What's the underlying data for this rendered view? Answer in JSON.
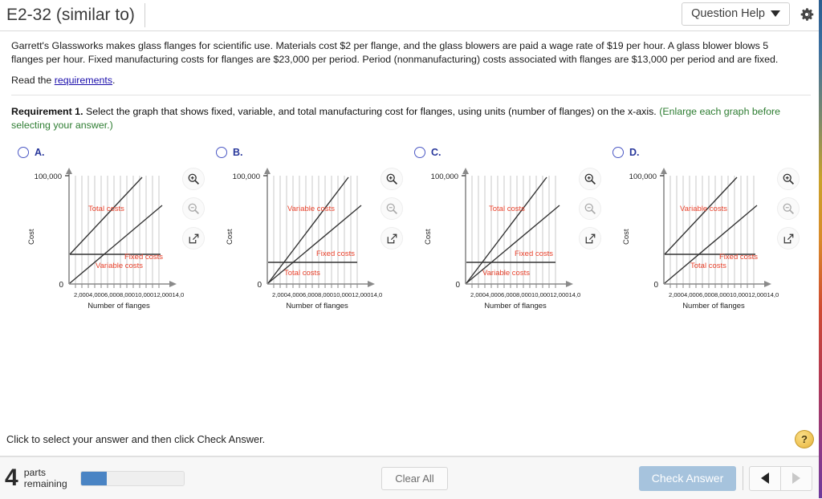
{
  "header": {
    "question_title": "E2-32 (similar to)",
    "question_help_label": "Question Help",
    "gear_icon": "gear-icon",
    "caret_icon": "chevron-down-icon"
  },
  "problem": {
    "text": "Garrett's Glassworks makes glass flanges for scientific use. Materials cost $2 per flange, and the glass blowers are paid a wage rate of $19 per hour. A glass blower blows 5 flanges per hour. Fixed manufacturing costs for flanges are $23,000 per period. Period (nonmanufacturing) costs associated with flanges are $13,000 per period and are fixed.",
    "read_prefix": "Read the ",
    "read_link": "requirements",
    "read_suffix": "."
  },
  "requirement": {
    "label": "Requirement 1.",
    "text": " Select the graph that shows fixed, variable, and total manufacturing cost for flanges, using units (number of flanges) on the x-axis. ",
    "note": "(Enlarge each graph before selecting your answer.)"
  },
  "options": [
    {
      "letter": "A.",
      "selected": false,
      "labels": {
        "upper": "Total costs",
        "lower": "Variable costs",
        "flat": "Fixed costs"
      }
    },
    {
      "letter": "B.",
      "selected": false,
      "labels": {
        "upper": "Variable costs",
        "lower": "Total costs",
        "flat": "Fixed costs"
      }
    },
    {
      "letter": "C.",
      "selected": false,
      "labels": {
        "upper": "Total costs",
        "lower": "Variable costs",
        "flat": "Fixed costs"
      }
    },
    {
      "letter": "D.",
      "selected": false,
      "labels": {
        "upper": "Variable costs",
        "lower": "Total costs",
        "flat": "Fixed costs"
      }
    }
  ],
  "graph_common": {
    "y_top_label": "100,000",
    "y_zero_label": "0",
    "y_axis_title": "Cost",
    "x_axis_title": "Number of flanges",
    "x_tick_labels": [
      "2,000",
      "4,000",
      "6,000",
      "8,000",
      "10,000",
      "12,000",
      "14,000"
    ],
    "line_color": "#333333",
    "label_color": "#e8402a",
    "grid_color": "#c9c9c9",
    "axis_color": "#8a8a8a"
  },
  "chart_data": [
    {
      "type": "line",
      "option": "A",
      "title": "Option A",
      "xlabel": "Number of flanges",
      "ylabel": "Cost",
      "xlim": [
        0,
        15000
      ],
      "ylim": [
        0,
        110000
      ],
      "ytick_labels": [
        "0",
        "100,000"
      ],
      "grid": true,
      "series": [
        {
          "name": "Total costs",
          "intercept": 23000,
          "slope_per_unit": 5.8,
          "label_position": "upper",
          "from_origin": false
        },
        {
          "name": "Variable costs",
          "intercept": 0,
          "slope_per_unit": 5.8,
          "label_position": "lower",
          "from_origin": true
        },
        {
          "name": "Fixed costs",
          "intercept": 23000,
          "slope_per_unit": 0,
          "label_position": "flat",
          "from_origin": false
        }
      ]
    },
    {
      "type": "line",
      "option": "B",
      "title": "Option B",
      "xlabel": "Number of flanges",
      "ylabel": "Cost",
      "xlim": [
        0,
        15000
      ],
      "ylim": [
        0,
        110000
      ],
      "ytick_labels": [
        "0",
        "100,000"
      ],
      "grid": true,
      "series": [
        {
          "name": "Variable costs",
          "intercept": 0,
          "slope_per_unit": 7.4,
          "label_position": "upper",
          "from_origin": true
        },
        {
          "name": "Total costs",
          "intercept": 0,
          "slope_per_unit": 5.3,
          "label_position": "lower",
          "from_origin": true
        },
        {
          "name": "Fixed costs",
          "intercept": 18000,
          "slope_per_unit": 0,
          "label_position": "flat",
          "from_origin": false
        }
      ]
    },
    {
      "type": "line",
      "option": "C",
      "title": "Option C",
      "xlabel": "Number of flanges",
      "ylabel": "Cost",
      "xlim": [
        0,
        15000
      ],
      "ylim": [
        0,
        110000
      ],
      "ytick_labels": [
        "0",
        "100,000"
      ],
      "grid": true,
      "series": [
        {
          "name": "Total costs",
          "intercept": 0,
          "slope_per_unit": 7.4,
          "label_position": "upper",
          "from_origin": true
        },
        {
          "name": "Variable costs",
          "intercept": 0,
          "slope_per_unit": 5.3,
          "label_position": "lower",
          "from_origin": true
        },
        {
          "name": "Fixed costs",
          "intercept": 18000,
          "slope_per_unit": 0,
          "label_position": "flat",
          "from_origin": false
        }
      ]
    },
    {
      "type": "line",
      "option": "D",
      "title": "Option D",
      "xlabel": "Number of flanges",
      "ylabel": "Cost",
      "xlim": [
        0,
        15000
      ],
      "ylim": [
        0,
        110000
      ],
      "ytick_labels": [
        "0",
        "100,000"
      ],
      "grid": true,
      "series": [
        {
          "name": "Variable costs",
          "intercept": 23000,
          "slope_per_unit": 5.8,
          "label_position": "upper",
          "from_origin": false
        },
        {
          "name": "Total costs",
          "intercept": 0,
          "slope_per_unit": 5.8,
          "label_position": "lower",
          "from_origin": true
        },
        {
          "name": "Fixed costs",
          "intercept": 23000,
          "slope_per_unit": 0,
          "label_position": "flat",
          "from_origin": false
        }
      ]
    }
  ],
  "graph_tools": {
    "zoom_in": "zoom-in-icon",
    "zoom_out": "zoom-out-icon",
    "open_popout": "open-in-new-window-icon"
  },
  "footer": {
    "hint": "Click to select your answer and then click Check Answer.",
    "help_bubble": "?",
    "parts_number": "4",
    "parts_line1": "parts",
    "parts_line2": "remaining",
    "progress_percent": 25,
    "clear_all": "Clear All",
    "check_answer": "Check Answer",
    "prev_icon": "triangle-left-icon",
    "next_icon": "triangle-right-icon"
  }
}
